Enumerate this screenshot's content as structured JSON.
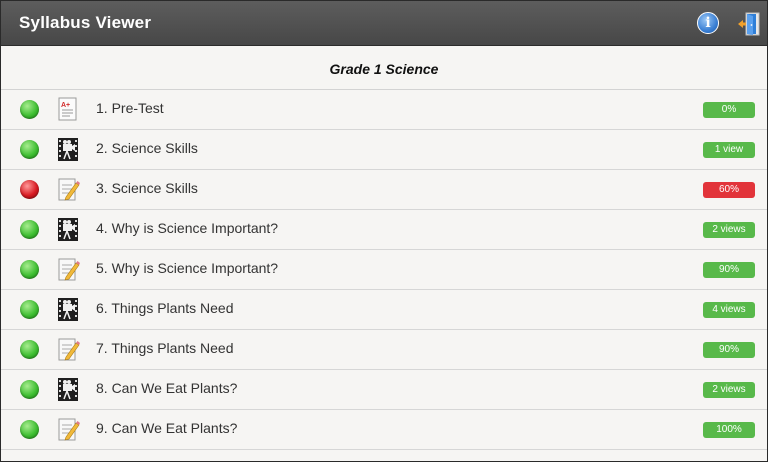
{
  "window": {
    "title": "Syllabus Viewer",
    "info_icon": "info-icon",
    "exit_icon": "exit-door-icon"
  },
  "course": {
    "title": "Grade 1 Science"
  },
  "colors": {
    "green_status": "#3fbf32",
    "red_status": "#d81a22",
    "badge_green": "#58b94a",
    "badge_red": "#e2343a"
  },
  "items": [
    {
      "label": "1. Pre-Test",
      "type": "test",
      "status": "green",
      "badge": "0%",
      "badge_color": "green"
    },
    {
      "label": "2. Science Skills",
      "type": "video",
      "status": "green",
      "badge": "1 view",
      "badge_color": "green"
    },
    {
      "label": "3. Science Skills",
      "type": "quiz",
      "status": "red",
      "badge": "60%",
      "badge_color": "red"
    },
    {
      "label": "4. Why is Science Important?",
      "type": "video",
      "status": "green",
      "badge": "2 views",
      "badge_color": "green"
    },
    {
      "label": "5. Why is Science Important?",
      "type": "quiz",
      "status": "green",
      "badge": "90%",
      "badge_color": "green"
    },
    {
      "label": "6. Things Plants Need",
      "type": "video",
      "status": "green",
      "badge": "4 views",
      "badge_color": "green"
    },
    {
      "label": "7. Things Plants Need",
      "type": "quiz",
      "status": "green",
      "badge": "90%",
      "badge_color": "green"
    },
    {
      "label": "8. Can We Eat Plants?",
      "type": "video",
      "status": "green",
      "badge": "2 views",
      "badge_color": "green"
    },
    {
      "label": "9. Can We Eat Plants?",
      "type": "quiz",
      "status": "green",
      "badge": "100%",
      "badge_color": "green"
    }
  ]
}
